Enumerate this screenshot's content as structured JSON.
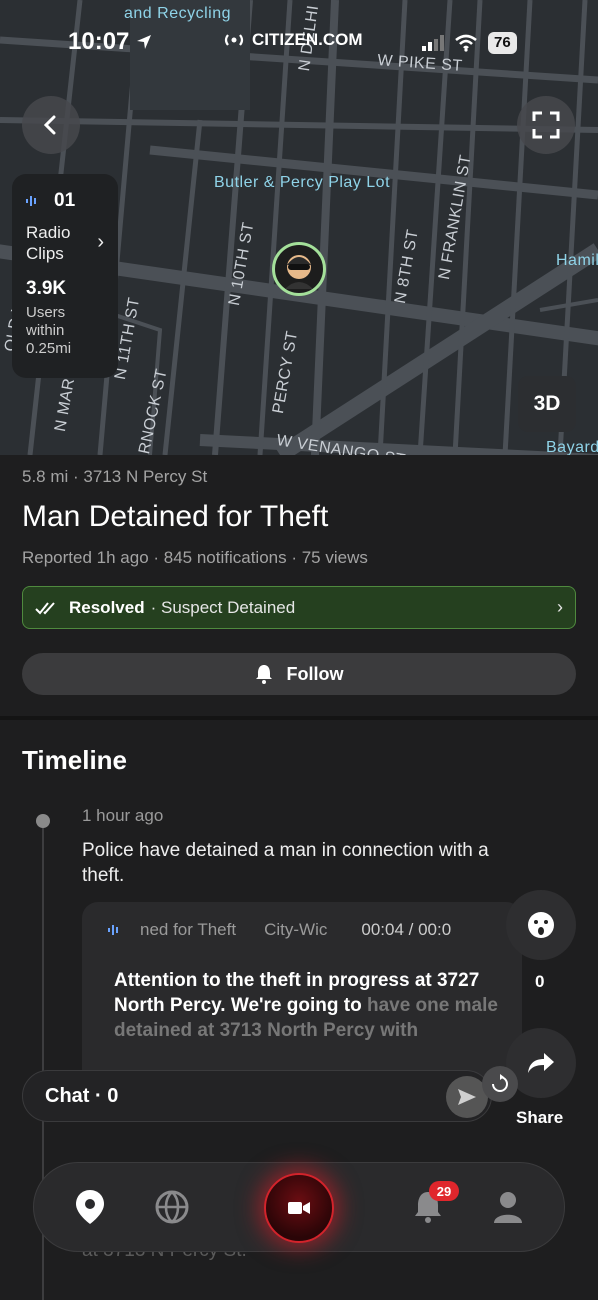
{
  "status_bar": {
    "time": "10:07",
    "carrier": "CITIZEN.COM",
    "battery": "76"
  },
  "map": {
    "labels": {
      "recycling": "and Recycling",
      "w_pike": "W PIKE ST",
      "n_delhi": "N DELHI",
      "playlot": "Butler & Percy Play Lot",
      "n_franklin": "N FRANKLIN ST",
      "n_8th": "N 8TH ST",
      "n_10th": "N 10TH ST",
      "percy": "PERCY ST",
      "w_venango": "W VENANGO ST",
      "hamil": "Hamil",
      "bayard": "Bayard",
      "rnock": "RNOCK ST",
      "n_mar": "N MAR",
      "old_yo": "OLD YO",
      "n_11th": "N 11TH ST"
    },
    "radio_count": "01",
    "radio_label": "Radio Clips",
    "users_count": "3.9K",
    "users_label": "Users within 0.25mi",
    "btn_3d": "3D"
  },
  "incident": {
    "meta": "5.8 mi · 3713 N Percy St",
    "title": "Man Detained for Theft",
    "sub": "Reported 1h ago · 845 notifications · 75 views",
    "status_strong": "Resolved",
    "status_rest": "· Suspect Detained",
    "follow_label": "Follow"
  },
  "timeline": {
    "heading": "Timeline",
    "entry_time": "1 hour ago",
    "entry_text": "Police have detained a man in connection with a theft.",
    "clip_title": "ned for Theft",
    "clip_scope": "City-Wic",
    "clip_time": "00:04 / 00:0",
    "clip_text_bright": "Attention to the theft in progress at 3727 North Percy. We're going to",
    "clip_text_dim": "have one male detained at 3713 North Percy with",
    "ghost_text": "at 3713 N Percy St."
  },
  "actions": {
    "reaction_count": "0",
    "share_label": "Share",
    "chat_label": "Chat · 0"
  },
  "nav": {
    "badge": "29"
  },
  "colors": {
    "resolved_bg": "#25401f",
    "resolved_border": "#4f8a3e",
    "camera_glow": "#d3232b",
    "badge": "#e0262c",
    "pin_ring": "#a4e09a"
  }
}
